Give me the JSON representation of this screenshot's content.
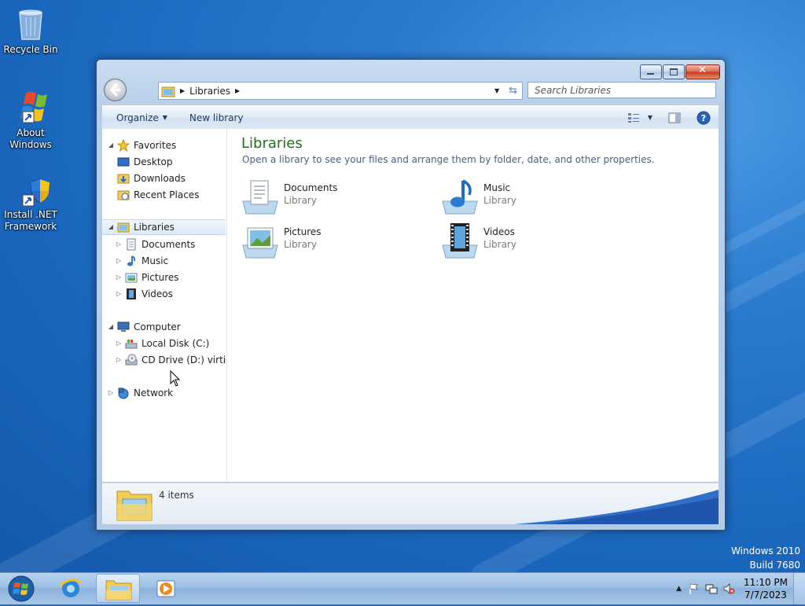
{
  "desktop": {
    "icons": [
      {
        "label": "Recycle Bin"
      },
      {
        "label_line1": "About",
        "label_line2": "Windows"
      },
      {
        "label_line1": "Install .NET",
        "label_line2": "Framework"
      }
    ],
    "watermark_line1": "Windows 2010",
    "watermark_line2": "Build 7680"
  },
  "window": {
    "address": {
      "crumb": "Libraries"
    },
    "search": {
      "placeholder": "Search Libraries"
    },
    "toolbar": {
      "organize": "Organize",
      "new_library": "New library"
    },
    "nav": {
      "favorites": "Favorites",
      "desktop": "Desktop",
      "downloads": "Downloads",
      "recent": "Recent Places",
      "libraries": "Libraries",
      "documents": "Documents",
      "music": "Music",
      "pictures": "Pictures",
      "videos": "Videos",
      "computer": "Computer",
      "local_disk": "Local Disk (C:)",
      "cd_drive": "CD Drive (D:) virtio-w",
      "network": "Network"
    },
    "main": {
      "title": "Libraries",
      "description": "Open a library to see your files and arrange them by folder, date, and other properties.",
      "items": [
        {
          "name": "Documents",
          "type": "Library"
        },
        {
          "name": "Music",
          "type": "Library"
        },
        {
          "name": "Pictures",
          "type": "Library"
        },
        {
          "name": "Videos",
          "type": "Library"
        }
      ]
    },
    "details": {
      "count": "4 items"
    }
  },
  "taskbar": {
    "time": "11:10 PM",
    "date": "7/7/2023"
  },
  "colors": {
    "accent": "#1f6e1f",
    "desktop": "#1b68bf"
  }
}
